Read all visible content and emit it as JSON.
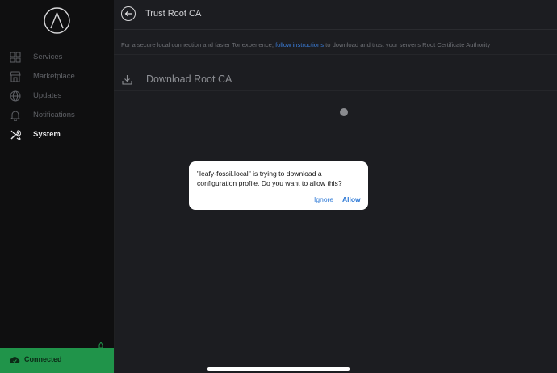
{
  "sidebar": {
    "items": [
      {
        "label": "Services",
        "icon": "grid-icon",
        "active": false
      },
      {
        "label": "Marketplace",
        "icon": "store-icon",
        "active": false
      },
      {
        "label": "Updates",
        "icon": "globe-icon",
        "active": false
      },
      {
        "label": "Notifications",
        "icon": "bell-icon",
        "active": false
      },
      {
        "label": "System",
        "icon": "tools-icon",
        "active": true
      }
    ],
    "status": "Connected"
  },
  "header": {
    "title": "Trust Root CA"
  },
  "info": {
    "prefix": "For a secure local connection and faster Tor experience, ",
    "link": "follow instructions",
    "suffix": " to download and trust your server's Root Certificate Authority"
  },
  "download": {
    "label": "Download Root CA"
  },
  "dialog": {
    "message": "\"leafy-fossil.local\" is trying to download a configuration profile. Do you want to allow this?",
    "ignore": "Ignore",
    "allow": "Allow"
  },
  "colors": {
    "accent": "#20944a",
    "link": "#3a7bd5",
    "background": "#1c1d21"
  }
}
